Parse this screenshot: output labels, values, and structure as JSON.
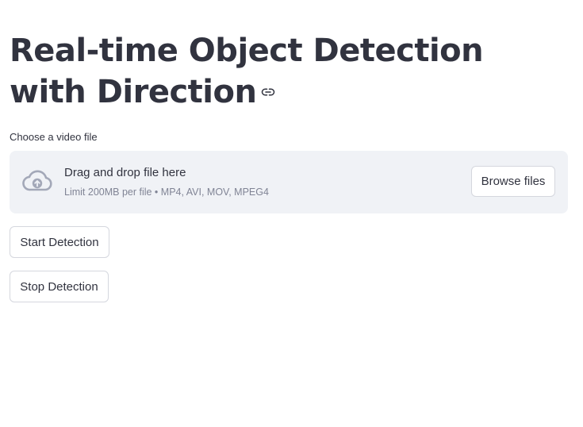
{
  "header": {
    "title": "Real-time Object Detection with Direction",
    "anchor_icon": "link-icon"
  },
  "uploader": {
    "label": "Choose a video file",
    "drop_text": "Drag and drop file here",
    "limit_text": "Limit 200MB per file • MP4, AVI, MOV, MPEG4",
    "browse_label": "Browse files",
    "icon": "cloud-upload-icon"
  },
  "actions": {
    "start_label": "Start Detection",
    "stop_label": "Stop Detection"
  },
  "colors": {
    "text": "#31333f",
    "muted": "#808495",
    "dropzone_bg": "#f0f2f6",
    "icon": "#a3a8b8"
  }
}
